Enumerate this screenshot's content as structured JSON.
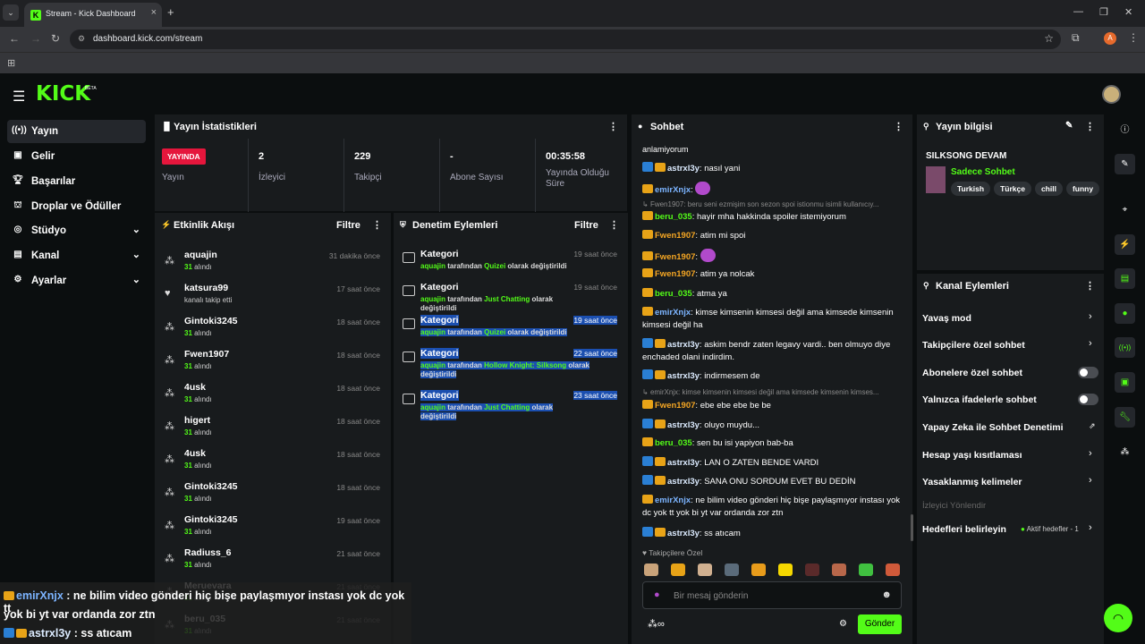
{
  "browser": {
    "tab_title": "Stream - Kick Dashboard",
    "url": "dashboard.kick.com/stream",
    "profile_initial": "A"
  },
  "brand": {
    "logo": "KICK",
    "beta": "BETA",
    "accent": "#53fc18"
  },
  "sidebar": {
    "items": [
      {
        "label": "Yayın",
        "icon": "broadcast-icon",
        "active": true
      },
      {
        "label": "Gelir",
        "icon": "revenue-icon"
      },
      {
        "label": "Başarılar",
        "icon": "trophy-icon"
      },
      {
        "label": "Droplar ve Ödüller",
        "icon": "gift-icon"
      },
      {
        "label": "Stüdyo",
        "icon": "studio-icon",
        "expandable": true
      },
      {
        "label": "Kanal",
        "icon": "channel-icon",
        "expandable": true
      },
      {
        "label": "Ayarlar",
        "icon": "settings-icon",
        "expandable": true
      }
    ]
  },
  "stats": {
    "title": "Yayın İstatistikleri",
    "live_badge": "YAYINDA",
    "live_label": "Yayın",
    "viewers_value": "2",
    "viewers_label": "İzleyici",
    "followers_value": "229",
    "followers_label": "Takipçi",
    "subs_value": "-",
    "subs_label": "Abone Sayısı",
    "uptime_value": "00:35:58",
    "uptime_label": "Yayında Olduğu Süre"
  },
  "activity": {
    "title": "Etkinlik Akışı",
    "filter": "Filtre",
    "items": [
      {
        "name": "aquajin",
        "sub": "31",
        "sub_text": "alındı",
        "time": "31 dakika önce",
        "icon": "sub-icon"
      },
      {
        "name": "katsura99",
        "sub": "",
        "sub_text": "kanalı takip etti",
        "time": "17 saat önce",
        "icon": "heart-icon"
      },
      {
        "name": "Gintoki3245",
        "sub": "31",
        "sub_text": "alındı",
        "time": "18 saat önce",
        "icon": "sub-icon"
      },
      {
        "name": "Fwen1907",
        "sub": "31",
        "sub_text": "alındı",
        "time": "18 saat önce",
        "icon": "sub-icon"
      },
      {
        "name": "4usk",
        "sub": "31",
        "sub_text": "alındı",
        "time": "18 saat önce",
        "icon": "sub-icon"
      },
      {
        "name": "higert",
        "sub": "31",
        "sub_text": "alındı",
        "time": "18 saat önce",
        "icon": "sub-icon"
      },
      {
        "name": "4usk",
        "sub": "31",
        "sub_text": "alındı",
        "time": "18 saat önce",
        "icon": "sub-icon"
      },
      {
        "name": "Gintoki3245",
        "sub": "31",
        "sub_text": "alındı",
        "time": "18 saat önce",
        "icon": "sub-icon"
      },
      {
        "name": "Gintoki3245",
        "sub": "31",
        "sub_text": "alındı",
        "time": "19 saat önce",
        "icon": "sub-icon"
      },
      {
        "name": "Radiuss_6",
        "sub": "31",
        "sub_text": "alındı",
        "time": "21 saat önce",
        "icon": "sub-icon"
      },
      {
        "name": "Meruevara",
        "sub": "31",
        "sub_text": "alındı",
        "time": "21 saat önce",
        "icon": "sub-icon"
      },
      {
        "name": "beru_035",
        "sub": "31",
        "sub_text": "alındı",
        "time": "21 saat önce",
        "icon": "sub-icon"
      }
    ]
  },
  "moderation": {
    "title": "Denetim Eylemleri",
    "filter": "Filtre",
    "items": [
      {
        "title": "Kategori",
        "user": "aquajin",
        "mid": "tarafından",
        "cat": "Quizei",
        "end": "olarak değiştirildi",
        "time": "19 saat önce"
      },
      {
        "title": "Kategori",
        "user": "aquajin",
        "mid": "tarafından",
        "cat": "Just Chatting",
        "end": "olarak değiştirildi",
        "time": "19 saat önce"
      },
      {
        "title": "Kategori",
        "user": "aquajin",
        "mid": "tarafından",
        "cat": "Quizei",
        "end": "olarak değiştirildi",
        "time": "19 saat önce"
      },
      {
        "title": "Kategori",
        "user": "aquajin",
        "mid": "tarafından",
        "cat": "Hollow Knight: Silksong",
        "end": "olarak değiştirildi",
        "time": "22 saat önce"
      },
      {
        "title": "Kategori",
        "user": "aquajin",
        "mid": "tarafından",
        "cat": "Just Chatting",
        "end": "olarak değiştirildi",
        "time": "23 saat önce"
      }
    ]
  },
  "chat": {
    "title": "Sohbet",
    "top_partial": "anlamiyorum",
    "messages": [
      {
        "user": "astrxl3y",
        "color": "uw",
        "mod": true,
        "text": ": nasıl yani"
      },
      {
        "user": "emirXnjx",
        "color": "ub",
        "mod": false,
        "text": ":",
        "emote": true
      },
      {
        "system": "Fwen1907: beru seni ezmişim son sezon spoi istionmu isimli kullanıcıy..."
      },
      {
        "user": "beru_035",
        "color": "ug",
        "mod": false,
        "text": ": hayir mha hakkinda spoiler istemiyorum"
      },
      {
        "user": "Fwen1907",
        "color": "uo",
        "mod": false,
        "text": ": atim mi spoi"
      },
      {
        "user": "Fwen1907",
        "color": "uo",
        "mod": false,
        "text": ":",
        "emote": true
      },
      {
        "user": "Fwen1907",
        "color": "uo",
        "mod": false,
        "text": ": atim ya nolcak"
      },
      {
        "user": "beru_035",
        "color": "ug",
        "mod": false,
        "text": ": atma ya"
      },
      {
        "user": "emirXnjx",
        "color": "ub",
        "mod": false,
        "text": ": kimse kimsenin kimsesi değil ama kimsede kimsenin kimsesi değil ha"
      },
      {
        "user": "astrxl3y",
        "color": "uw",
        "mod": true,
        "text": ": askim bendr zaten legavy vardi.. ben olmuyo diye enchaded olani indirdim."
      },
      {
        "user": "astrxl3y",
        "color": "uw",
        "mod": true,
        "text": ": indirmesem de"
      },
      {
        "system": "emirXnjx: kimse kimsenin kimsesi değil ama kimsede kimsenin kimses..."
      },
      {
        "user": "Fwen1907",
        "color": "uo",
        "mod": false,
        "text": ": ebe ebe ebe be be"
      },
      {
        "user": "astrxl3y",
        "color": "uw",
        "mod": true,
        "text": ": oluyo muydu..."
      },
      {
        "user": "beru_035",
        "color": "ug",
        "mod": false,
        "text": ": sen bu isi yapiyon bab-ba"
      },
      {
        "user": "astrxl3y",
        "color": "uw",
        "mod": true,
        "text": ": LAN O ZATEN BENDE VARDI"
      },
      {
        "user": "astrxl3y",
        "color": "uw",
        "mod": true,
        "text": ": SANA ONU SORDUM EVET BU DEDİN"
      },
      {
        "user": "emirXnjx",
        "color": "ub",
        "mod": false,
        "text": ": ne bilim video gönderi hiç bişe paylaşmıyor instası yok dc yok tt yok bi yt var ordanda zor ztn"
      },
      {
        "user": "astrxl3y",
        "color": "uw",
        "mod": true,
        "text": ": ss atıcam"
      }
    ],
    "emote_section": "Takipçilere Özel",
    "placeholder": "Bir mesaj gönderin",
    "send": "Gönder"
  },
  "stream_info": {
    "title": "Yayın bilgisi",
    "stream_title": "SILKSONG DEVAM",
    "category": "Sadece Sohbet",
    "tags": [
      "Turkish",
      "Türkçe",
      "chill",
      "funny"
    ]
  },
  "channel_actions": {
    "title": "Kanal Eylemleri",
    "items": [
      {
        "label": "Yavaş mod",
        "type": "arrow"
      },
      {
        "label": "Takipçilere özel sohbet",
        "type": "arrow"
      },
      {
        "label": "Abonelere özel sohbet",
        "type": "toggle"
      },
      {
        "label": "Yalnızca ifadelerle sohbet",
        "type": "toggle"
      },
      {
        "label": "Yapay Zeka ile Sohbet Denetimi",
        "type": "ext"
      },
      {
        "label": "Hesap yaşı kısıtlaması",
        "type": "arrow"
      },
      {
        "label": "Yasaklanmış kelimeler",
        "type": "arrow"
      }
    ],
    "section": "İzleyici Yönlendir",
    "goals_label": "Hedefleri belirleyin",
    "goals_status": "Aktif hedefler - 1"
  },
  "overlay": {
    "line1_user": "emirXnjx",
    "line1_text": " : ne bilim video gönderi hiç bişe paylaşmıyor instası yok dc yok tt",
    "line2_text": "yok bi yt var ordanda zor ztn",
    "line3_user": "astrxl3y",
    "line3_text": " : ss atıcam"
  }
}
